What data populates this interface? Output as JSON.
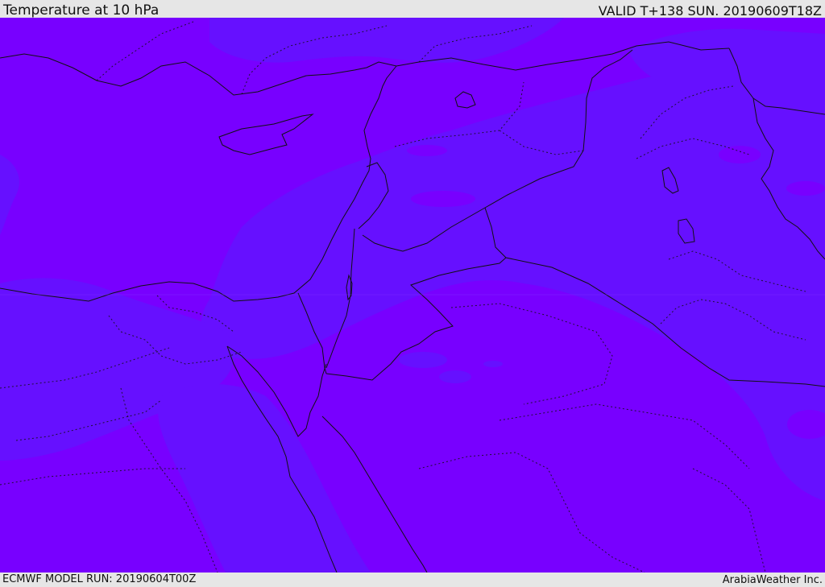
{
  "header": {
    "title": "Temperature at 10 hPa",
    "valid": "VALID T+138 SUN. 20190609T18Z"
  },
  "footer": {
    "model_run": "ECMWF MODEL RUN: 20190604T00Z",
    "credit": "ArabiaWeather Inc."
  },
  "map": {
    "colors": {
      "warmer_band": "#7800ff",
      "cooler_band": "#6610ff",
      "border_line": "#111111"
    }
  }
}
